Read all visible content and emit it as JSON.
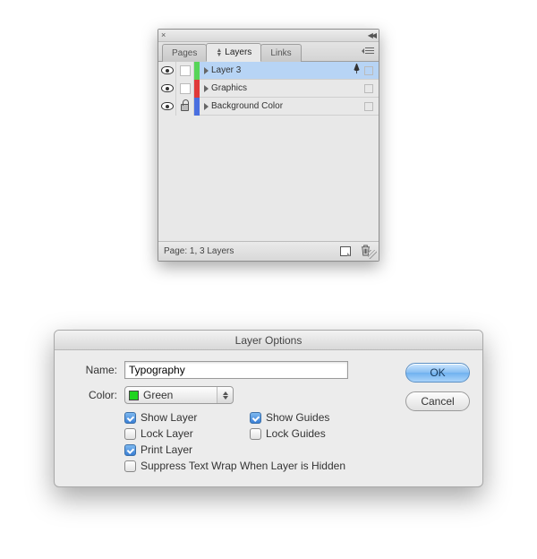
{
  "panel": {
    "tabs": {
      "pages": "Pages",
      "layers": "Layers",
      "links": "Links"
    },
    "layers": [
      {
        "name": "Layer 3",
        "color": "#57d557",
        "visible": true,
        "locked": false,
        "selected": true,
        "active_pen": true
      },
      {
        "name": "Graphics",
        "color": "#e03a3a",
        "visible": true,
        "locked": false,
        "selected": false,
        "active_pen": false
      },
      {
        "name": "Background Color",
        "color": "#4a6fe0",
        "visible": true,
        "locked": true,
        "selected": false,
        "active_pen": false
      }
    ],
    "footer_status": "Page: 1, 3 Layers"
  },
  "dialog": {
    "title": "Layer Options",
    "name_label": "Name:",
    "name_value": "Typography",
    "color_label": "Color:",
    "color_name": "Green",
    "color_hex": "#1fd41f",
    "checks": {
      "show_layer": "Show Layer",
      "lock_layer": "Lock Layer",
      "print_layer": "Print Layer",
      "show_guides": "Show Guides",
      "lock_guides": "Lock Guides",
      "suppress_wrap": "Suppress Text Wrap When Layer is Hidden"
    },
    "checked": {
      "show_layer": true,
      "lock_layer": false,
      "print_layer": true,
      "show_guides": true,
      "lock_guides": false,
      "suppress_wrap": false
    },
    "ok": "OK",
    "cancel": "Cancel"
  }
}
